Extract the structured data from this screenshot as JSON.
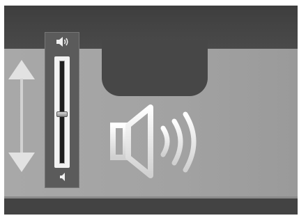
{
  "volume_control": {
    "level": 0.48,
    "orientation": "vertical",
    "icons": {
      "max": "speaker-loud-icon",
      "min": "speaker-quiet-icon",
      "main": "speaker-sound-waves-icon",
      "resize": "vertical-double-arrow-icon"
    }
  },
  "colors": {
    "panel_bg": "#a5a5a5",
    "frame_bg": "#474747",
    "slider_panel_bg": "#5b5b5b",
    "icon_fill": "#f0f0f0"
  }
}
